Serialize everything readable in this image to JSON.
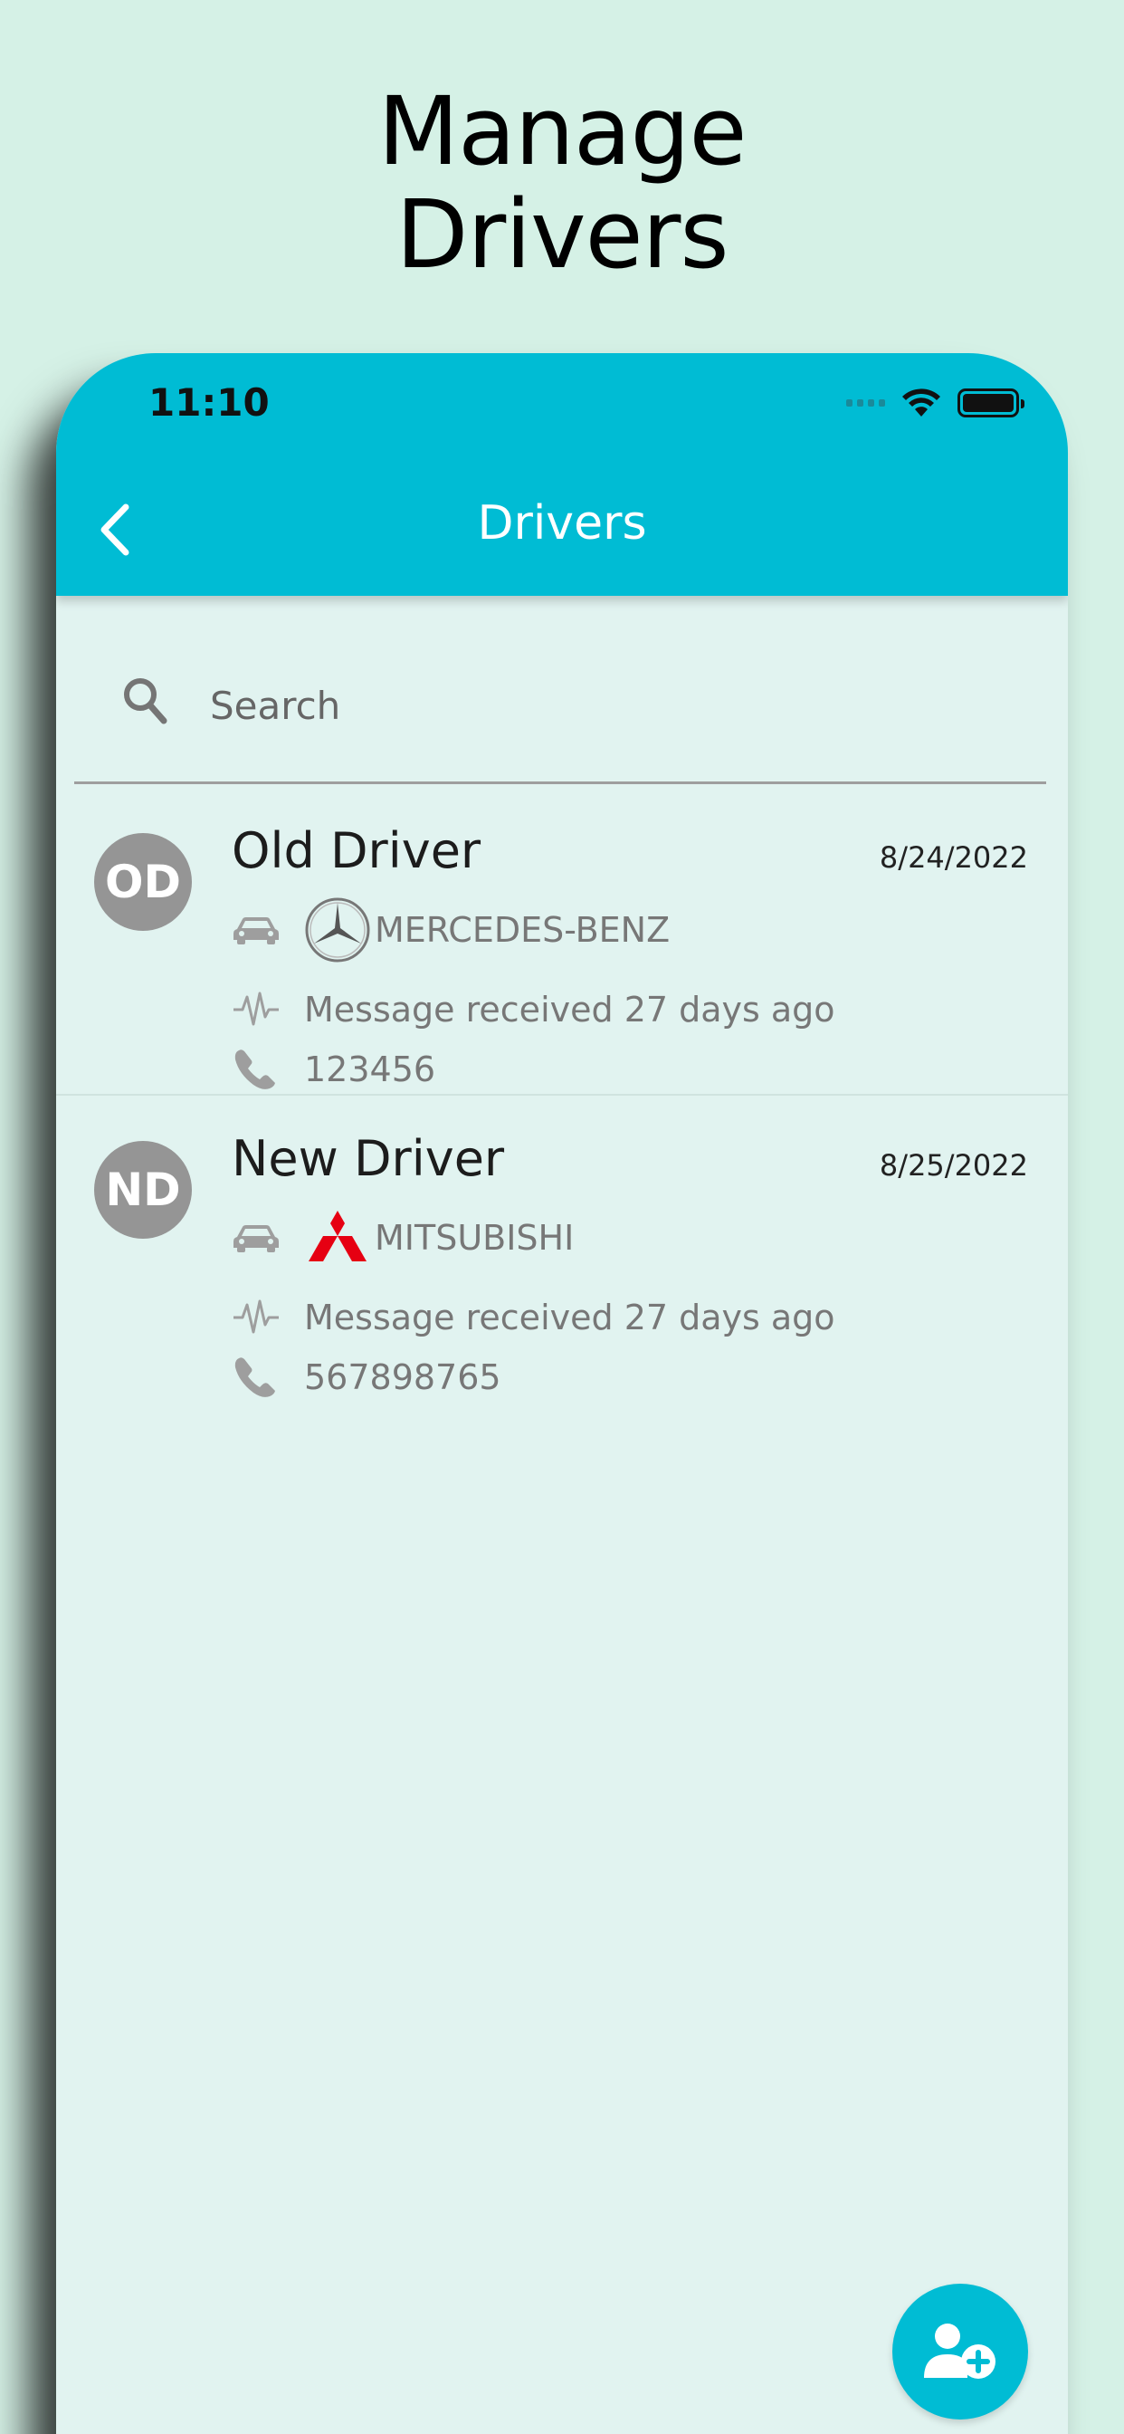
{
  "promo": {
    "line1": "Manage",
    "line2": "Drivers"
  },
  "status_bar": {
    "time": "11:10"
  },
  "nav": {
    "title": "Drivers"
  },
  "search": {
    "placeholder": "Search"
  },
  "drivers": [
    {
      "initials": "OD",
      "name": "Old Driver",
      "date": "8/24/2022",
      "brand": "MERCEDES-BENZ",
      "message": "Message received 27 days ago",
      "phone": "123456"
    },
    {
      "initials": "ND",
      "name": "New Driver",
      "date": "8/25/2022",
      "brand": "MITSUBISHI",
      "message": "Message received 27 days ago",
      "phone": "567898765"
    }
  ],
  "colors": {
    "background": "#d5f1e6",
    "app_bar": "#00bcd4",
    "list_background": "#e1f3f0",
    "avatar": "#959595",
    "mitsubishi_red": "#e60012"
  }
}
